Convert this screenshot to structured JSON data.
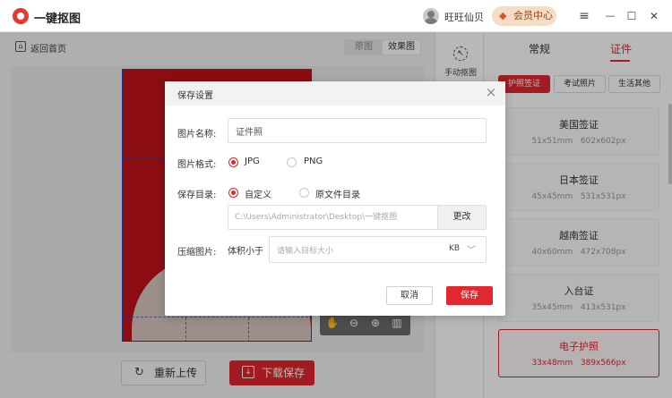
{
  "app": {
    "name": "一键抠图"
  },
  "titlebar": {
    "username": "旺旺仙贝",
    "vip_label": "会员中心",
    "vip_icon": "diamond-icon"
  },
  "window_controls": [
    {
      "name": "menu-icon",
      "glyph": "≡"
    },
    {
      "name": "minimize-icon",
      "glyph": "—"
    },
    {
      "name": "maximize-icon",
      "glyph": "☐"
    },
    {
      "name": "close-icon",
      "glyph": "✕"
    }
  ],
  "workspace": {
    "back_label": "返回首页",
    "view_tabs": [
      "原图",
      "效果图"
    ],
    "active_view": "效果图",
    "reupload_label": "重新上传",
    "download_label": "下载保存",
    "background_color": "#c1121a"
  },
  "toolbar": {
    "manual_label": "手动抠图"
  },
  "panel": {
    "tabs": [
      "常规",
      "证件"
    ],
    "active_tab": "证件",
    "categories": [
      "护照签证",
      "考试照片",
      "生活其他"
    ],
    "active_category": "护照签证",
    "sizes": [
      {
        "name": "美国签证",
        "mm": "51x51mm",
        "px": "602x602px"
      },
      {
        "name": "日本签证",
        "mm": "45x45mm",
        "px": "531x531px"
      },
      {
        "name": "越南签证",
        "mm": "40x60mm",
        "px": "472x708px"
      },
      {
        "name": "入台证",
        "mm": "35x45mm",
        "px": "413x531px"
      },
      {
        "name": "电子护照",
        "mm": "33x48mm",
        "px": "389x566px"
      }
    ],
    "selected_size": "电子护照"
  },
  "dialog": {
    "title": "保存设置",
    "name_label": "图片名称:",
    "name_value": "证件照",
    "format_label": "图片格式:",
    "formats": [
      "JPG",
      "PNG"
    ],
    "selected_format": "JPG",
    "dir_label": "保存目录:",
    "dir_options": [
      "自定义",
      "原文件目录"
    ],
    "selected_dir": "自定义",
    "path": "C:\\Users\\Administrator\\Desktop\\一键抠图",
    "change_label": "更改",
    "compress_label": "压缩图片:",
    "compress_prefix": "体积小于",
    "size_placeholder": "请输入目标大小",
    "unit": "KB",
    "cancel_label": "取消",
    "save_label": "保存"
  },
  "colors": {
    "accent": "#e0282e"
  }
}
